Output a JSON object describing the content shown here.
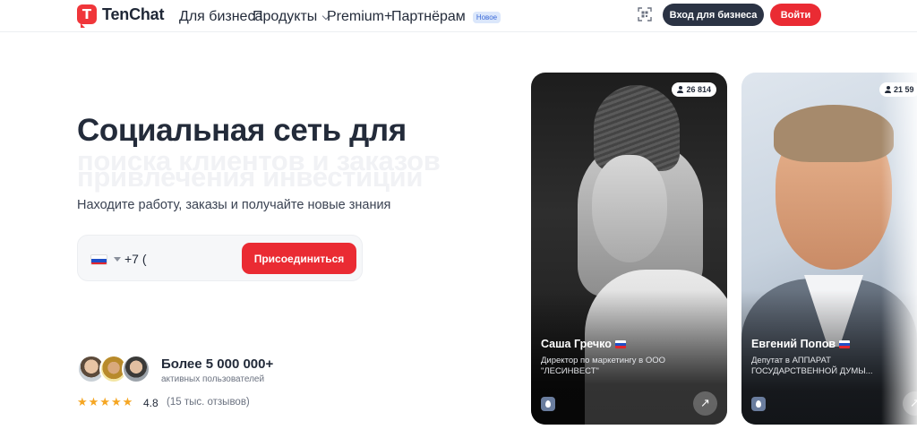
{
  "header": {
    "logo_text": "TenChat",
    "nav": [
      {
        "label": "Для бизнеса"
      },
      {
        "label": "Продукты"
      },
      {
        "label": "Premium+"
      },
      {
        "label": "Партнёрам",
        "badge": "Новое"
      }
    ],
    "business_login": "Вход для бизнеса",
    "login": "Войти"
  },
  "hero": {
    "title": "Социальная сеть для",
    "ghost_line_1": "поиска клиентов и заказов",
    "ghost_line_2": "привлечения инвестиций",
    "subtitle": "Находите работу, заказы и получайте новые знания",
    "phone_value": "+7 (",
    "join_label": "Присоединиться"
  },
  "social_proof": {
    "users_count": "Более 5 000 000+",
    "users_label": "активных пользователей",
    "rating": "4.8",
    "reviews": "(15 тыс. отзывов)",
    "stars": 5
  },
  "cards": [
    {
      "followers": "26 814",
      "name": "Саша Гречко",
      "role": "Директор по маркетингу в ООО \"ЛЕСИНВЕСТ\""
    },
    {
      "followers": "21 59",
      "name": "Евгений Попов",
      "role": "Депутат в АППАРАТ ГОСУДАРСТВЕННОЙ ДУМЫ..."
    }
  ],
  "colors": {
    "brand_red": "#ea2b33",
    "dark_button": "#2b3344",
    "star": "#f5a623",
    "new_badge_bg": "#dbe7fb"
  },
  "icons": {
    "qr": "qr-scan-icon",
    "arrow": "arrow-up-right-icon",
    "person": "person-icon"
  }
}
